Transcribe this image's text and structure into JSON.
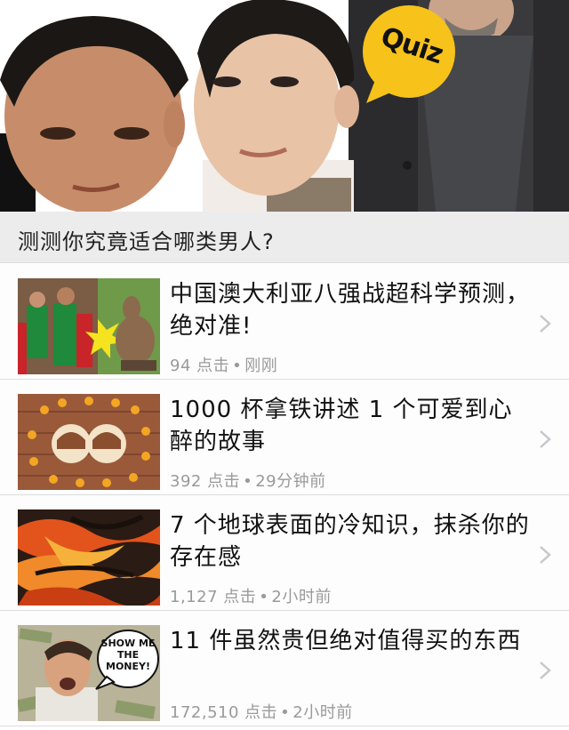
{
  "hero": {
    "badge_text": "Quiz",
    "badge_color": "#f7c21a"
  },
  "section": {
    "title": "测测你究竟适合哪类男人?"
  },
  "articles": [
    {
      "title": "中国澳大利亚八强战超科学预测，绝对准!",
      "clicks": "94 点击",
      "separator": "•",
      "time": "刚刚",
      "thumb_icon": "soccer-kangaroo-image"
    },
    {
      "title": "1000 杯拿铁讲述 1 个可爱到心醉的故事",
      "clicks": "392 点击",
      "separator": "•",
      "time": "29分钟前",
      "thumb_icon": "latte-art-image"
    },
    {
      "title": "7 个地球表面的冷知识，抹杀你的存在感",
      "clicks": "1,127 点击",
      "separator": "•",
      "time": "2小时前",
      "thumb_icon": "lava-image"
    },
    {
      "title": "11 件虽然贵但绝对值得买的东西",
      "clicks": "172,510 点击",
      "separator": "•",
      "time": "2小时前",
      "thumb_icon": "show-me-the-money-image",
      "thumb_caption": "SHOW ME THE MONEY!"
    }
  ],
  "colors": {
    "section_bg": "#ececec",
    "meta_text": "#9a9a9a",
    "chevron": "#c7c7cc"
  }
}
